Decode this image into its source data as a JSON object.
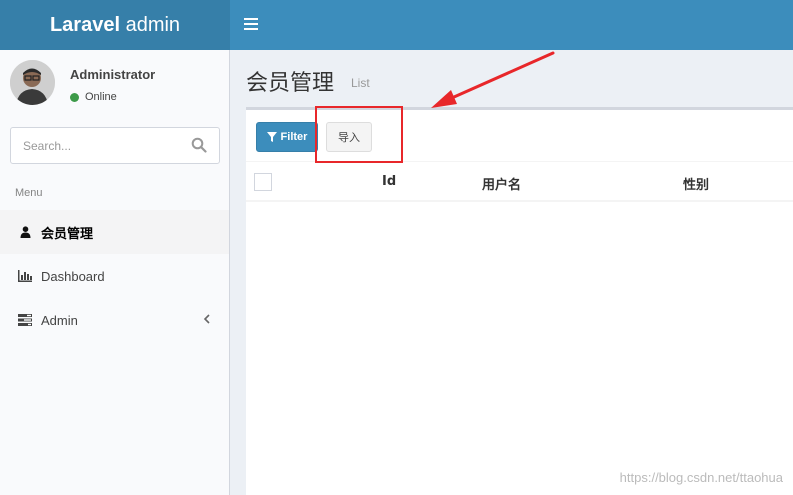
{
  "app": {
    "logo_bold": "Laravel",
    "logo_rest": " admin"
  },
  "user": {
    "name": "Administrator",
    "status": "Online"
  },
  "search": {
    "placeholder": "Search..."
  },
  "menu": {
    "header": "Menu",
    "items": [
      {
        "label": "会员管理",
        "icon": "user-icon",
        "active": true
      },
      {
        "label": "Dashboard",
        "icon": "bar-chart-icon",
        "active": false
      },
      {
        "label": "Admin",
        "icon": "tasks-icon",
        "active": false,
        "has_submenu": true
      }
    ]
  },
  "page": {
    "title": "会员管理",
    "subtitle": "List"
  },
  "toolbar": {
    "filter_label": "Filter",
    "import_label": "导入"
  },
  "table": {
    "columns": [
      "Id",
      "用户名",
      "性别"
    ]
  },
  "watermark": "https://blog.csdn.net/ttaohua",
  "colors": {
    "header": "#3c8dbc",
    "logo_bg": "#367fa9",
    "annotation": "#e8272a"
  }
}
